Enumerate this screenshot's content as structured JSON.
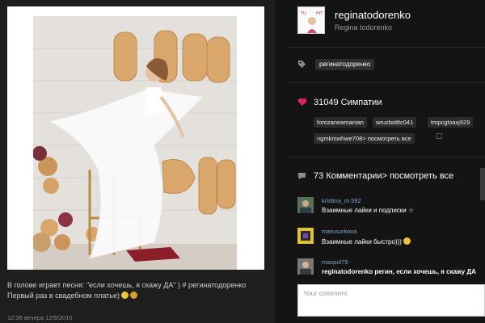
{
  "profile": {
    "username": "reginatodorenko",
    "full_name": "Regina todorenko",
    "avatar_icon": "profile-photo-icon"
  },
  "tags": {
    "icon": "tag-icon",
    "hashtag": "регинатодоренко"
  },
  "likes": {
    "icon": "heart-icon",
    "count": "31049",
    "label": "Симпатии",
    "likers": [
      "forozaneamanian",
      "wrucbotltc041",
      "tmpcgloaxj929",
      "ngmkmwhwe708> посмотреть все"
    ]
  },
  "comments": {
    "icon": "speech-bubble-icon",
    "count": "73",
    "label": "Комментарии> посмотреть все",
    "items": [
      {
        "user": "kristina_m.592",
        "text": "Взаимные лайки и подписки ☆"
      },
      {
        "user": "marusurkova",
        "text": "Взаимные лайки быстро)))"
      },
      {
        "user": "maxpol79",
        "text": "reginatodorenko регин, если хочешь, я скажу ДА"
      }
    ],
    "input_placeholder": "Your comment"
  },
  "post": {
    "caption": "В голове играет песня: \"если хочешь, я скажу ДА\" ) # регинатодоренко Первый раз в свадебном платье)",
    "time": "12:36 вечера 12/5/2015"
  },
  "colors": {
    "background": "#141414",
    "accent_heart": "#e0245e",
    "username_link": "#7fa8d8",
    "balloon_gold": "#d9a66b"
  }
}
